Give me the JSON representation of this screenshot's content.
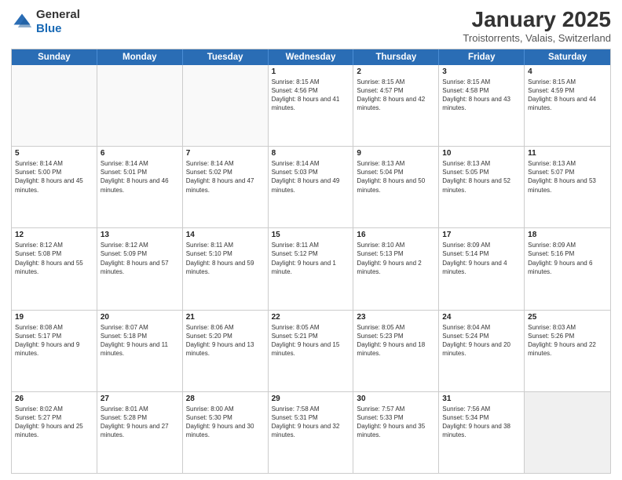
{
  "header": {
    "logo_general": "General",
    "logo_blue": "Blue",
    "month_title": "January 2025",
    "location": "Troistorrents, Valais, Switzerland"
  },
  "day_headers": [
    "Sunday",
    "Monday",
    "Tuesday",
    "Wednesday",
    "Thursday",
    "Friday",
    "Saturday"
  ],
  "weeks": [
    [
      {
        "num": "",
        "info": ""
      },
      {
        "num": "",
        "info": ""
      },
      {
        "num": "",
        "info": ""
      },
      {
        "num": "1",
        "info": "Sunrise: 8:15 AM\nSunset: 4:56 PM\nDaylight: 8 hours and 41 minutes."
      },
      {
        "num": "2",
        "info": "Sunrise: 8:15 AM\nSunset: 4:57 PM\nDaylight: 8 hours and 42 minutes."
      },
      {
        "num": "3",
        "info": "Sunrise: 8:15 AM\nSunset: 4:58 PM\nDaylight: 8 hours and 43 minutes."
      },
      {
        "num": "4",
        "info": "Sunrise: 8:15 AM\nSunset: 4:59 PM\nDaylight: 8 hours and 44 minutes."
      }
    ],
    [
      {
        "num": "5",
        "info": "Sunrise: 8:14 AM\nSunset: 5:00 PM\nDaylight: 8 hours and 45 minutes."
      },
      {
        "num": "6",
        "info": "Sunrise: 8:14 AM\nSunset: 5:01 PM\nDaylight: 8 hours and 46 minutes."
      },
      {
        "num": "7",
        "info": "Sunrise: 8:14 AM\nSunset: 5:02 PM\nDaylight: 8 hours and 47 minutes."
      },
      {
        "num": "8",
        "info": "Sunrise: 8:14 AM\nSunset: 5:03 PM\nDaylight: 8 hours and 49 minutes."
      },
      {
        "num": "9",
        "info": "Sunrise: 8:13 AM\nSunset: 5:04 PM\nDaylight: 8 hours and 50 minutes."
      },
      {
        "num": "10",
        "info": "Sunrise: 8:13 AM\nSunset: 5:05 PM\nDaylight: 8 hours and 52 minutes."
      },
      {
        "num": "11",
        "info": "Sunrise: 8:13 AM\nSunset: 5:07 PM\nDaylight: 8 hours and 53 minutes."
      }
    ],
    [
      {
        "num": "12",
        "info": "Sunrise: 8:12 AM\nSunset: 5:08 PM\nDaylight: 8 hours and 55 minutes."
      },
      {
        "num": "13",
        "info": "Sunrise: 8:12 AM\nSunset: 5:09 PM\nDaylight: 8 hours and 57 minutes."
      },
      {
        "num": "14",
        "info": "Sunrise: 8:11 AM\nSunset: 5:10 PM\nDaylight: 8 hours and 59 minutes."
      },
      {
        "num": "15",
        "info": "Sunrise: 8:11 AM\nSunset: 5:12 PM\nDaylight: 9 hours and 1 minute."
      },
      {
        "num": "16",
        "info": "Sunrise: 8:10 AM\nSunset: 5:13 PM\nDaylight: 9 hours and 2 minutes."
      },
      {
        "num": "17",
        "info": "Sunrise: 8:09 AM\nSunset: 5:14 PM\nDaylight: 9 hours and 4 minutes."
      },
      {
        "num": "18",
        "info": "Sunrise: 8:09 AM\nSunset: 5:16 PM\nDaylight: 9 hours and 6 minutes."
      }
    ],
    [
      {
        "num": "19",
        "info": "Sunrise: 8:08 AM\nSunset: 5:17 PM\nDaylight: 9 hours and 9 minutes."
      },
      {
        "num": "20",
        "info": "Sunrise: 8:07 AM\nSunset: 5:18 PM\nDaylight: 9 hours and 11 minutes."
      },
      {
        "num": "21",
        "info": "Sunrise: 8:06 AM\nSunset: 5:20 PM\nDaylight: 9 hours and 13 minutes."
      },
      {
        "num": "22",
        "info": "Sunrise: 8:05 AM\nSunset: 5:21 PM\nDaylight: 9 hours and 15 minutes."
      },
      {
        "num": "23",
        "info": "Sunrise: 8:05 AM\nSunset: 5:23 PM\nDaylight: 9 hours and 18 minutes."
      },
      {
        "num": "24",
        "info": "Sunrise: 8:04 AM\nSunset: 5:24 PM\nDaylight: 9 hours and 20 minutes."
      },
      {
        "num": "25",
        "info": "Sunrise: 8:03 AM\nSunset: 5:26 PM\nDaylight: 9 hours and 22 minutes."
      }
    ],
    [
      {
        "num": "26",
        "info": "Sunrise: 8:02 AM\nSunset: 5:27 PM\nDaylight: 9 hours and 25 minutes."
      },
      {
        "num": "27",
        "info": "Sunrise: 8:01 AM\nSunset: 5:28 PM\nDaylight: 9 hours and 27 minutes."
      },
      {
        "num": "28",
        "info": "Sunrise: 8:00 AM\nSunset: 5:30 PM\nDaylight: 9 hours and 30 minutes."
      },
      {
        "num": "29",
        "info": "Sunrise: 7:58 AM\nSunset: 5:31 PM\nDaylight: 9 hours and 32 minutes."
      },
      {
        "num": "30",
        "info": "Sunrise: 7:57 AM\nSunset: 5:33 PM\nDaylight: 9 hours and 35 minutes."
      },
      {
        "num": "31",
        "info": "Sunrise: 7:56 AM\nSunset: 5:34 PM\nDaylight: 9 hours and 38 minutes."
      },
      {
        "num": "",
        "info": ""
      }
    ]
  ]
}
